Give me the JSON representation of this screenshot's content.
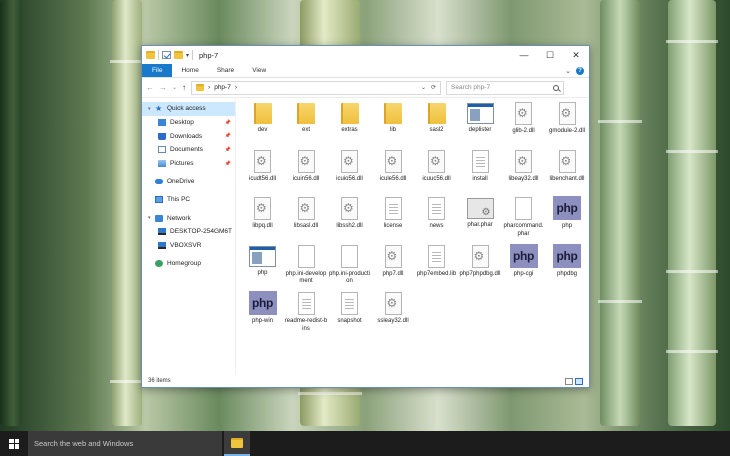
{
  "window": {
    "title": "php-7",
    "controls": {
      "minimize": "—",
      "maximize": "☐",
      "close": "✕"
    }
  },
  "ribbon": {
    "tabs": [
      "File",
      "Home",
      "Share",
      "View"
    ],
    "expand_icon": "chevron-down-icon",
    "help_label": "?"
  },
  "address": {
    "back": "←",
    "forward": "→",
    "up": "↑",
    "path_sep": "›",
    "path": "php-7",
    "path_trail": "›",
    "dropdown": "⌄",
    "refresh": "⟳",
    "search_placeholder": "Search php-7"
  },
  "nav": {
    "quick_access": "Quick access",
    "desktop": "Desktop",
    "downloads": "Downloads",
    "documents": "Documents",
    "pictures": "Pictures",
    "onedrive": "OneDrive",
    "this_pc": "This PC",
    "network": "Network",
    "desktop_pc": "DESKTOP-254GM6T",
    "vboxsvr": "VBOXSVR",
    "homegroup": "Homegroup",
    "pin": "📌"
  },
  "files": [
    {
      "name": "dev",
      "icon": "folder"
    },
    {
      "name": "ext",
      "icon": "folder"
    },
    {
      "name": "extras",
      "icon": "folder"
    },
    {
      "name": "lib",
      "icon": "folder"
    },
    {
      "name": "sasl2",
      "icon": "folder"
    },
    {
      "name": "deplister",
      "icon": "app"
    },
    {
      "name": "glib-2.dll",
      "icon": "gear"
    },
    {
      "name": "gmodule-2.dll",
      "icon": "gear"
    },
    {
      "name": "icudt56.dll",
      "icon": "gear"
    },
    {
      "name": "icuin56.dll",
      "icon": "gear"
    },
    {
      "name": "icuio56.dll",
      "icon": "gear"
    },
    {
      "name": "icule56.dll",
      "icon": "gear"
    },
    {
      "name": "icuuc56.dll",
      "icon": "gear"
    },
    {
      "name": "install",
      "icon": "doc"
    },
    {
      "name": "libeay32.dll",
      "icon": "gear"
    },
    {
      "name": "libenchant.dll",
      "icon": "gear"
    },
    {
      "name": "libpq.dll",
      "icon": "gear"
    },
    {
      "name": "libsasl.dll",
      "icon": "gear"
    },
    {
      "name": "libssh2.dll",
      "icon": "gear"
    },
    {
      "name": "license",
      "icon": "doc"
    },
    {
      "name": "news",
      "icon": "doc"
    },
    {
      "name": "phar.phar",
      "icon": "phar"
    },
    {
      "name": "pharcommand.phar",
      "icon": "blank"
    },
    {
      "name": "php",
      "icon": "php"
    },
    {
      "name": "php",
      "icon": "app"
    },
    {
      "name": "php.ini-development",
      "icon": "blank"
    },
    {
      "name": "php.ini-production",
      "icon": "blank"
    },
    {
      "name": "php7.dll",
      "icon": "gear"
    },
    {
      "name": "php7embed.lib",
      "icon": "doc"
    },
    {
      "name": "php7phpdbg.dll",
      "icon": "gear"
    },
    {
      "name": "php-cgi",
      "icon": "php"
    },
    {
      "name": "phpdbg",
      "icon": "php"
    },
    {
      "name": "php-win",
      "icon": "php"
    },
    {
      "name": "readme-redist-bins",
      "icon": "doc"
    },
    {
      "name": "snapshot",
      "icon": "doc"
    },
    {
      "name": "ssleay32.dll",
      "icon": "gear"
    }
  ],
  "php_logo_text": "php",
  "status": {
    "count": "36 items"
  },
  "taskbar": {
    "search_placeholder": "Search the web and Windows"
  }
}
